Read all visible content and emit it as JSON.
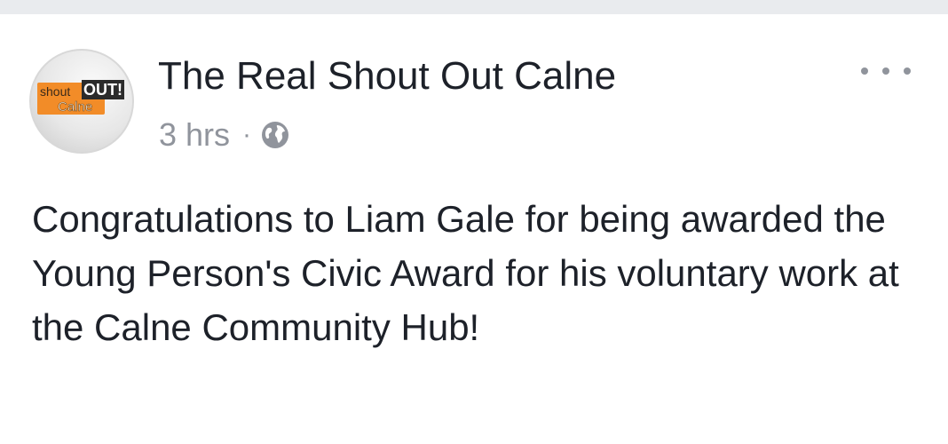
{
  "post": {
    "page_name": "The Real Shout Out Calne",
    "time": "3 hrs",
    "separator": "·",
    "privacy_icon": "globe-icon",
    "more_icon": "more-options-icon",
    "text": "Congratulations to Liam Gale for being awarded the Young Person's Civic Award for his voluntary work at the Calne Community Hub!",
    "avatar": {
      "word_shout": "shout",
      "word_out": "OUT!",
      "word_calne": "Calne"
    }
  },
  "colors": {
    "name_text": "#1d2129",
    "meta_text": "#90949c",
    "logo_orange": "#f28c28",
    "top_strip": "#e9ebee"
  }
}
